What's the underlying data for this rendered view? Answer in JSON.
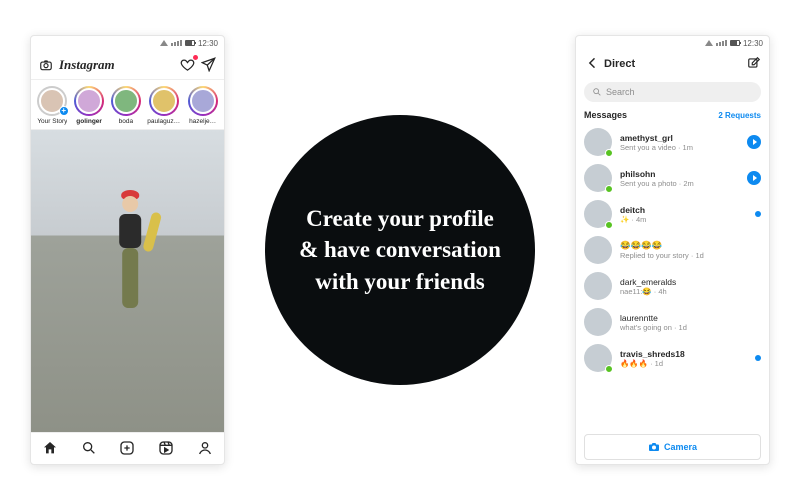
{
  "statusbar": {
    "time": "12:30"
  },
  "hero": {
    "text": "Create your profile & have conversation with your friends"
  },
  "feed": {
    "brand": "Instagram",
    "stories": [
      {
        "label": "Your Story",
        "ring": false,
        "add": true
      },
      {
        "label": "golinger",
        "ring": true,
        "bold": true
      },
      {
        "label": "boda",
        "ring": true
      },
      {
        "label": "paulaguzm…",
        "ring": true
      },
      {
        "label": "hazelje…",
        "ring": true
      }
    ]
  },
  "dm": {
    "title": "Direct",
    "search_placeholder": "Search",
    "section": "Messages",
    "requests": "2 Requests",
    "camera": "Camera",
    "items": [
      {
        "name": "amethyst_grl",
        "preview": "Sent you a video · 1m",
        "unread": true,
        "media": true,
        "presence": true
      },
      {
        "name": "philsohn",
        "preview": "Sent you a photo · 2m",
        "unread": true,
        "media": true,
        "presence": true
      },
      {
        "name": "deitch",
        "preview": "✨ · 4m",
        "unread": true,
        "media": false,
        "presence": true
      },
      {
        "name": "😂😂😂😂",
        "preview": "Replied to your story · 1d",
        "unread": false,
        "media": false,
        "presence": false
      },
      {
        "name": "dark_emeralds",
        "preview": "nae11:😂 · 4h",
        "unread": false,
        "media": false,
        "presence": false
      },
      {
        "name": "laurenntte",
        "preview": "what's going on · 1d",
        "unread": false,
        "media": false,
        "presence": false
      },
      {
        "name": "travis_shreds18",
        "preview": "🔥🔥🔥 · 1d",
        "unread": true,
        "media": false,
        "presence": true
      }
    ]
  }
}
